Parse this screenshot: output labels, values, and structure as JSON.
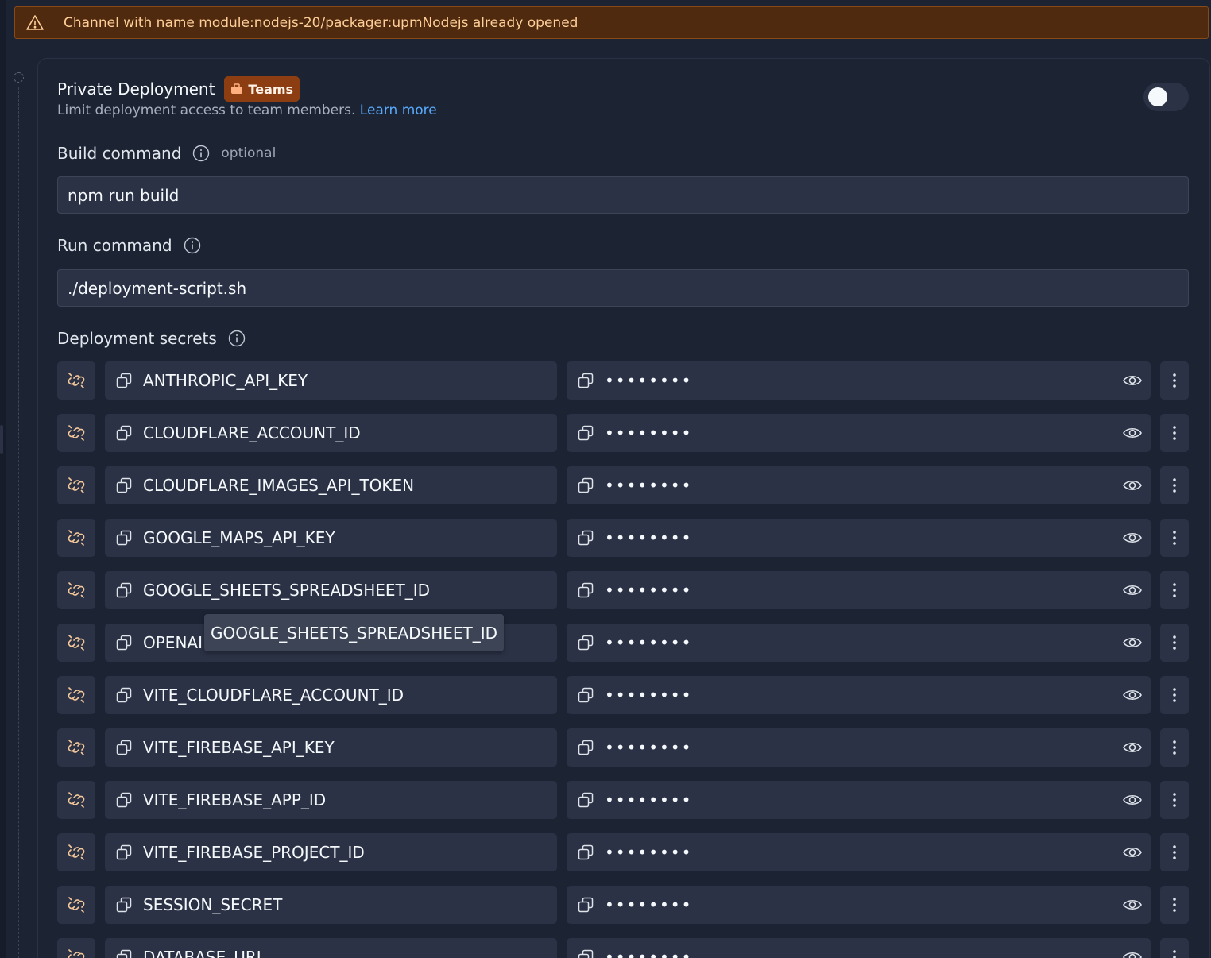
{
  "banner": {
    "message": "Channel with name module:nodejs-20/packager:upmNodejs already opened",
    "icon": "warning-triangle-icon"
  },
  "private_deployment": {
    "title": "Private Deployment",
    "badge": "Teams",
    "description": "Limit deployment access to team members.",
    "learn_more": "Learn more",
    "enabled": false
  },
  "build_command": {
    "label": "Build command",
    "optional": "optional",
    "value": "npm run build"
  },
  "run_command": {
    "label": "Run command",
    "value": "./deployment-script.sh"
  },
  "secrets": {
    "label": "Deployment secrets",
    "masked_value": "••••••••",
    "items": [
      {
        "key": "ANTHROPIC_API_KEY"
      },
      {
        "key": "CLOUDFLARE_ACCOUNT_ID"
      },
      {
        "key": "CLOUDFLARE_IMAGES_API_TOKEN"
      },
      {
        "key": "GOOGLE_MAPS_API_KEY"
      },
      {
        "key": "GOOGLE_SHEETS_SPREADSHEET_ID"
      },
      {
        "key": "OPENAI"
      },
      {
        "key": "VITE_CLOUDFLARE_ACCOUNT_ID"
      },
      {
        "key": "VITE_FIREBASE_API_KEY"
      },
      {
        "key": "VITE_FIREBASE_APP_ID"
      },
      {
        "key": "VITE_FIREBASE_PROJECT_ID"
      },
      {
        "key": "SESSION_SECRET"
      },
      {
        "key": "DATABASE_URL"
      }
    ]
  },
  "tooltip": {
    "text": "GOOGLE_SHEETS_SPREADSHEET_ID"
  },
  "colors": {
    "background": "#1c2333",
    "surface": "#2b3245",
    "banner_bg": "#4f2a0e",
    "banner_text": "#ffcf99",
    "badge_bg": "#8c3e12",
    "link": "#57abff"
  }
}
